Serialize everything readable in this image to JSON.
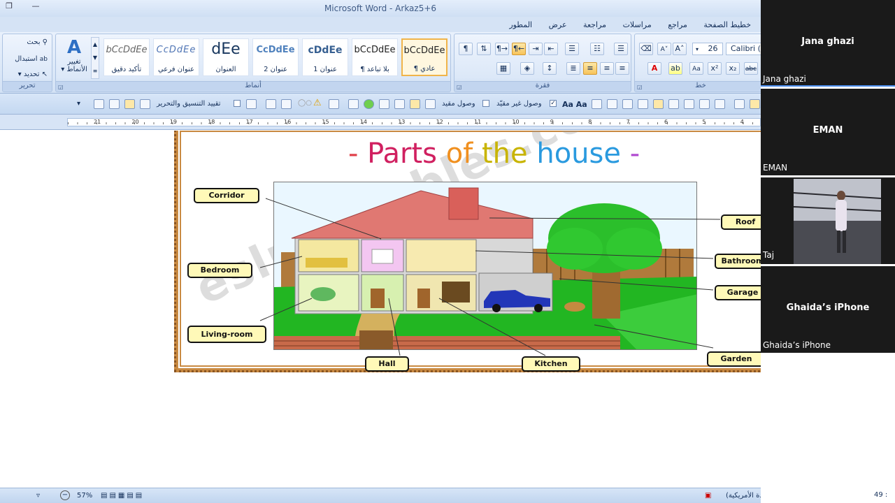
{
  "window": {
    "title": "Microsoft Word - Arkaz5+6"
  },
  "tabs": [
    "خطيط الصفحة",
    "مراجع",
    "مراسلات",
    "مراجعة",
    "عرض",
    "المطور"
  ],
  "ribbon": {
    "editing": {
      "find": "بحث",
      "replace": "استبدال",
      "select": "تحديد",
      "label": "تحرير"
    },
    "change_styles": {
      "line1": "تغيير",
      "line2": "الأنماط"
    },
    "styles": {
      "label": "أنماط",
      "items": [
        {
          "sample": "bCcDdEe",
          "name": "تأكيد دقيق"
        },
        {
          "sample": "CcDdEe",
          "name": "عنوان فرعي"
        },
        {
          "sample": "dEe",
          "name": "العنوان"
        },
        {
          "sample": "CcDdEe",
          "name": "عنوان 2"
        },
        {
          "sample": "cDdEe",
          "name": "عنوان 1"
        },
        {
          "sample": "bCcDdEe",
          "name": "¶ بلا تباعد"
        },
        {
          "sample": "bCcDdEe",
          "name": "¶ عادي"
        }
      ]
    },
    "paragraph": {
      "label": "فقرة"
    },
    "font": {
      "label": "خط",
      "size": "26",
      "name": "Calibri ("
    }
  },
  "quick_access": {
    "restrict": "تقييد التنسيق والتحرير",
    "linked": "وصول مقيد",
    "unlinked": "وصول غير مقيّد"
  },
  "ruler": {
    "numbers": [
      "21",
      "20",
      "19",
      "18",
      "17",
      "16",
      "15",
      "14",
      "13",
      "12",
      "11",
      "10",
      "9",
      "8",
      "7",
      "6",
      "5",
      "4"
    ]
  },
  "worksheet": {
    "title_prefix": "-",
    "title_words": [
      "Parts",
      "of",
      "the",
      "house"
    ],
    "title_suffix": "-",
    "watermark": "eslprintables.com",
    "labels": {
      "corridor": "Corridor",
      "bedroom": "Bedroom",
      "living_room": "Living-room",
      "hall": "Hall",
      "kitchen": "Kitchen",
      "garden": "Garden",
      "roof": "Roof",
      "bathroom": "Bathroom",
      "garage": "Garage"
    }
  },
  "status": {
    "zoom": "57%",
    "language": "الإنجليزية (الولايات المتحدة الأمريكية)",
    "word_count": "49 :"
  },
  "participants": [
    {
      "display": "Jana ghazi",
      "label": "Jana ghazi",
      "video": false
    },
    {
      "display": "EMAN",
      "label": "EMAN",
      "video": false
    },
    {
      "display": "",
      "label": "Taj",
      "video": true
    },
    {
      "display": "Ghaida’s iPhone",
      "label": "Ghaida’s iPhone",
      "video": false
    }
  ],
  "colors": {
    "ribbon": "#dce8f8",
    "frame": "#c98a42",
    "label_fill": "#fff9b8",
    "roof": "#e07872",
    "grass": "#22b622"
  }
}
